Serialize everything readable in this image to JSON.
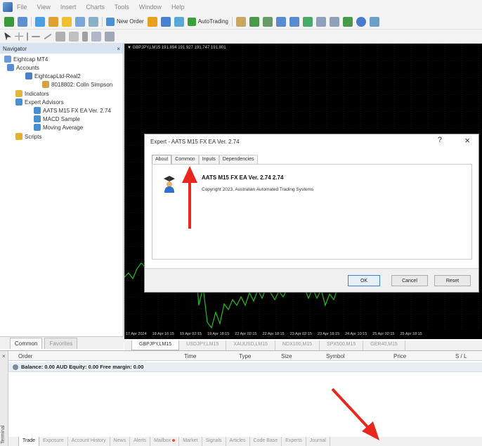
{
  "menu": {
    "items": [
      "File",
      "View",
      "Insert",
      "Charts",
      "Tools",
      "Window",
      "Help"
    ]
  },
  "toolbar": {
    "new_order_label": "New Order",
    "autotrading_label": "AutoTrading"
  },
  "navigator": {
    "title": "Navigator",
    "close_glyph": "×",
    "tree": [
      {
        "label": "Eightcap MT4",
        "icon": "folder-icon"
      },
      {
        "label": "Accounts",
        "icon": "accounts-icon"
      },
      {
        "label": "EightcapLtd-Real2",
        "icon": "server-icon"
      },
      {
        "label": "8018802: Colin Simpson",
        "icon": "user-icon"
      },
      {
        "label": "Indicators",
        "icon": "indicators-icon"
      },
      {
        "label": "Expert Advisors",
        "icon": "expert-icon"
      },
      {
        "label": "AATS M15 FX EA Ver. 2.74",
        "icon": "expert-icon"
      },
      {
        "label": "MACD Sample",
        "icon": "expert-icon"
      },
      {
        "label": "Moving Average",
        "icon": "expert-icon"
      },
      {
        "label": "Scripts",
        "icon": "scripts-icon"
      }
    ],
    "tabs": [
      "Common",
      "Favorites"
    ]
  },
  "chart": {
    "title": "▼ GBPJPY,LM15  191.894 191.927 191.747 191.801",
    "dates": [
      "17 Apr 2024",
      "18 Apr 16:15",
      "19 Apr 02:15",
      "19 Apr 18:15",
      "22 Apr 02:15",
      "22 Apr 18:15",
      "23 Apr 02:15",
      "23 Apr 18:15",
      "24 Apr 10:15",
      "25 Apr 02:15",
      "25 Apr 18:15"
    ],
    "symbol_tabs": [
      "GBPJPY,LM15",
      "USDJPY,LM15",
      "XAUUSD,LM15",
      "NDX100,M15",
      "SPX500,M15",
      "GER40,M15"
    ],
    "active_symbol": 0,
    "line_color": "#1fbf1f"
  },
  "dialog": {
    "title": "Expert - AATS M15 FX EA Ver. 2.74",
    "help_glyph": "?",
    "close_glyph": "×",
    "tabs": [
      "About",
      "Common",
      "Inputs",
      "Dependencies"
    ],
    "active_tab": 0,
    "ea_name": "AATS M15 FX EA Ver. 2.74 2.74",
    "copyright": "Copyright 2023, Australian Automated Trading Systems",
    "buttons": {
      "ok": "OK",
      "cancel": "Cancel",
      "reset": "Reset"
    }
  },
  "terminal": {
    "side_label": "Terminal",
    "close_glyph": "×",
    "columns": [
      "Order",
      "Time",
      "Type",
      "Size",
      "Symbol",
      "Price",
      "S / L"
    ],
    "balance_line": "Balance: 0.00 AUD  Equity: 0.00  Free margin: 0.00",
    "tabs": [
      "Trade",
      "Exposure",
      "Account History",
      "News",
      "Alerts",
      "Mailbox",
      "Market",
      "Signals",
      "Articles",
      "Code Base",
      "Experts",
      "Journal"
    ],
    "active_tab": 0
  },
  "colors": {
    "annotation_arrow": "#e8281e",
    "chart_background": "#000000",
    "navigator_header": "#d9e4f2"
  }
}
